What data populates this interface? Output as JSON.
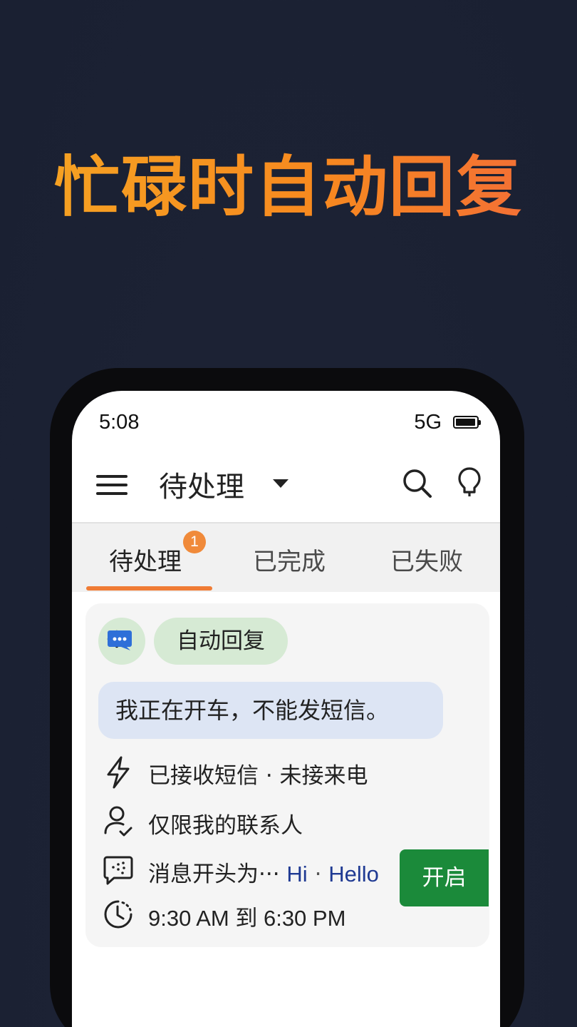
{
  "headline": "忙碌时自动回复",
  "status_bar": {
    "time": "5:08",
    "network": "5G"
  },
  "app_bar": {
    "title": "待处理"
  },
  "tabs": [
    {
      "label": "待处理",
      "badge": "1",
      "active": true
    },
    {
      "label": "已完成"
    },
    {
      "label": "已失败"
    }
  ],
  "card": {
    "chip_label": "自动回复",
    "message": "我正在开车，不能发短信。",
    "trigger": "已接收短信 · 未接来电",
    "contacts": "仅限我的联系人",
    "starts_with_prefix": "消息开头为···",
    "keyword_1": "Hi",
    "keyword_separator": "·",
    "keyword_2": "Hello",
    "schedule": "9:30 AM 到 6:30 PM"
  },
  "actions": {
    "enable_label": "开启"
  },
  "colors": {
    "accent": "#f07c35",
    "green": "#1b8a3a",
    "chip_bg": "#d6ead4",
    "bubble_bg": "#dde5f4"
  }
}
